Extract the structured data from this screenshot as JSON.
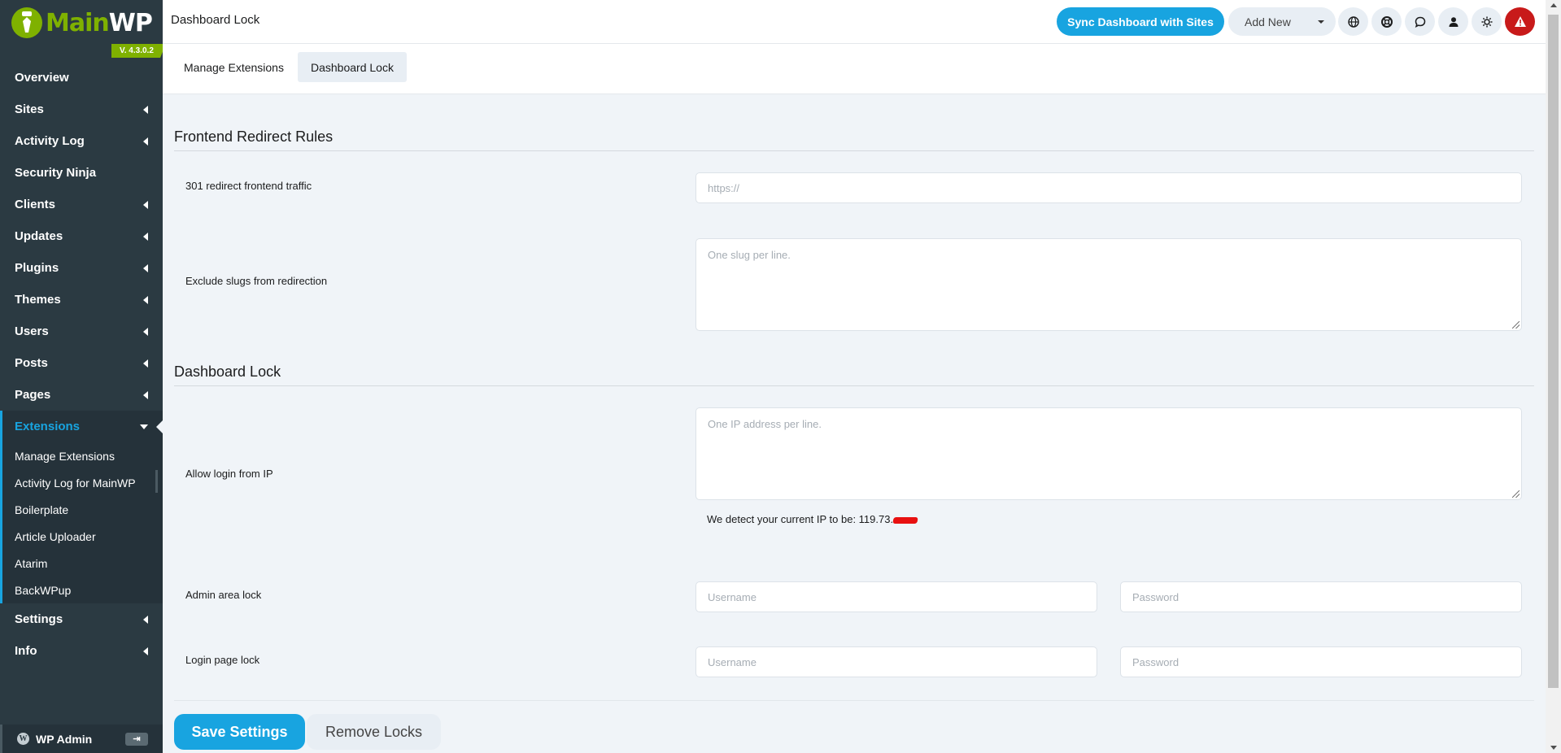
{
  "app": {
    "logo_main": "Main",
    "logo_wp": "WP",
    "version": "V. 4.3.0.2"
  },
  "sidebar": {
    "items": [
      {
        "label": "Overview"
      },
      {
        "label": "Sites"
      },
      {
        "label": "Activity Log"
      },
      {
        "label": "Security Ninja"
      },
      {
        "label": "Clients"
      },
      {
        "label": "Updates"
      },
      {
        "label": "Plugins"
      },
      {
        "label": "Themes"
      },
      {
        "label": "Users"
      },
      {
        "label": "Posts"
      },
      {
        "label": "Pages"
      },
      {
        "label": "Extensions"
      }
    ],
    "subitems": [
      {
        "label": "Manage Extensions"
      },
      {
        "label": "Activity Log for MainWP"
      },
      {
        "label": "Boilerplate"
      },
      {
        "label": "Article Uploader"
      },
      {
        "label": "Atarim"
      },
      {
        "label": "BackWPup"
      }
    ],
    "bottom_items": [
      {
        "label": "Settings"
      },
      {
        "label": "Info"
      }
    ],
    "wp_admin_label": "WP Admin"
  },
  "header": {
    "title": "Dashboard Lock",
    "sync_label": "Sync Dashboard with Sites",
    "add_new_label": "Add New"
  },
  "tabs": [
    {
      "label": "Manage Extensions"
    },
    {
      "label": "Dashboard Lock"
    }
  ],
  "redirect": {
    "section_title": "Frontend Redirect Rules",
    "redirect_label": "301 redirect frontend traffic",
    "redirect_placeholder": "https://",
    "exclude_label": "Exclude slugs from redirection",
    "exclude_placeholder": "One slug per line."
  },
  "lock": {
    "section_title": "Dashboard Lock",
    "ip_label": "Allow login from IP",
    "ip_placeholder": "One IP address per line.",
    "ip_note": "We detect your current IP to be: 119.73.",
    "admin_label": "Admin area lock",
    "login_label": "Login page lock",
    "username_placeholder": "Username",
    "password_placeholder": "Password"
  },
  "actions": {
    "save_label": "Save Settings",
    "remove_label": "Remove Locks"
  },
  "colors": {
    "brand_green": "#7fb100",
    "accent_blue": "#18a4e0",
    "sidebar_bg": "#2b3a42",
    "alert_red": "#c81a1a"
  }
}
